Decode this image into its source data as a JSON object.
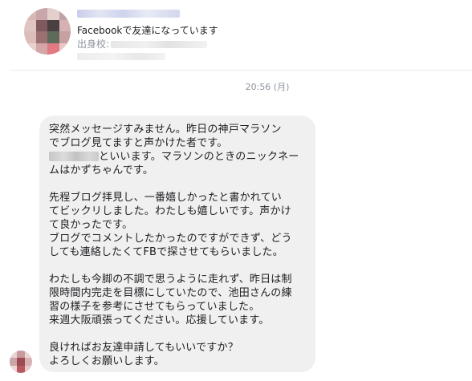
{
  "profile": {
    "friends_text": "Facebookで友達になっています",
    "school_label": "出身校:",
    "avatar_colors": [
      "#d9b8b5",
      "#c9a6a9",
      "#e4cfcd",
      "#bfa3a6",
      "#e0c6c2",
      "#7e5a5e",
      "#4a4042",
      "#d6b3b2",
      "#ddbdb9",
      "#9c6f72",
      "#5e6a5a",
      "#c7a0a1",
      "#e8d2cf",
      "#d4a6a8",
      "#e27a84",
      "#e9c9c8"
    ]
  },
  "timestamp": "20:56 (月)",
  "message": {
    "lines": [
      "突然メッセージすみません。昨日の神戸マラソン",
      "でブログ見てますと声かけた者です。",
      "といいます。マラソンのときのニックネー",
      "ムはかずちゃんです。",
      "",
      "先程ブログ拝見し、一番嬉しかったと書かれてい",
      "てビックリしました。わたしも嬉しいです。声かけ",
      "て良かったです。",
      "ブログでコメントしたかったのですができず、どう",
      "しても連絡したくてFBで探させてもらいました。",
      "",
      "わたしも今脚の不調で思うように走れず、昨日は制",
      "限時間内完走を目標にしていたので、池田さんの練",
      "習の様子を参考にさせてもらっていました。",
      "来週大阪頑張ってください。応援しています。",
      "",
      "良ければお友達申請してもいいですか？",
      "よろしくお願いします。"
    ]
  },
  "sender_avatar_colors": [
    "#e9d4d2",
    "#c79aa0",
    "#ead6d3",
    "#caa4a6",
    "#9e4a52",
    "#d8b2b2",
    "#edd9d6",
    "#b8585f",
    "#e6cccb"
  ]
}
